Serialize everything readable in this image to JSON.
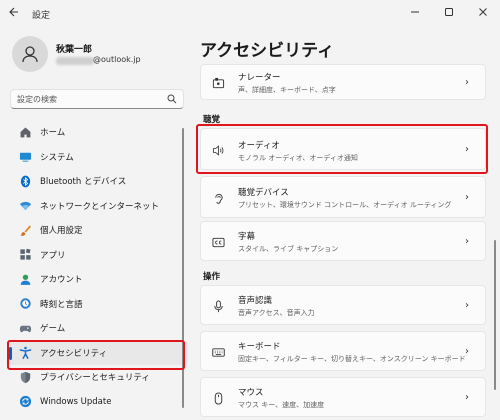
{
  "window": {
    "title": "設定",
    "back_icon": "back-arrow-icon",
    "controls": {
      "minimize": "—",
      "maximize": "☐",
      "close": "✕"
    }
  },
  "profile": {
    "name": "秋葉一郎",
    "email_suffix": "@outlook.jp"
  },
  "search": {
    "placeholder": "設定の検索"
  },
  "sidebar": {
    "items": [
      {
        "label": "ホーム",
        "icon": "home-icon"
      },
      {
        "label": "システム",
        "icon": "system-icon"
      },
      {
        "label": "Bluetooth とデバイス",
        "icon": "bluetooth-icon"
      },
      {
        "label": "ネットワークとインターネット",
        "icon": "wifi-icon"
      },
      {
        "label": "個人用設定",
        "icon": "brush-icon"
      },
      {
        "label": "アプリ",
        "icon": "apps-icon"
      },
      {
        "label": "アカウント",
        "icon": "account-icon"
      },
      {
        "label": "時刻と言語",
        "icon": "globe-clock-icon"
      },
      {
        "label": "ゲーム",
        "icon": "gamepad-icon"
      },
      {
        "label": "アクセシビリティ",
        "icon": "accessibility-icon",
        "selected": true
      },
      {
        "label": "プライバシーとセキュリティ",
        "icon": "shield-icon"
      },
      {
        "label": "Windows Update",
        "icon": "windows-update-icon"
      }
    ]
  },
  "main": {
    "title": "アクセシビリティ",
    "cards": [
      {
        "title": "ナレーター",
        "subtitle": "声、詳細度、キーボード、点字",
        "icon": "narrator-icon"
      },
      {
        "title": "オーディオ",
        "subtitle": "モノラル オーディオ、オーディオ通知",
        "icon": "speaker-icon"
      },
      {
        "title": "聴覚デバイス",
        "subtitle": "プリセット、環境サウンド コントロール、オーディオ ルーティング",
        "icon": "hearing-icon"
      },
      {
        "title": "字幕",
        "subtitle": "スタイル、ライブ キャプション",
        "icon": "captions-icon"
      },
      {
        "title": "音声認識",
        "subtitle": "音声アクセス、音声入力",
        "icon": "microphone-icon"
      },
      {
        "title": "キーボード",
        "subtitle": "固定キー、フィルター キー、切り替えキー、オンスクリーン キーボード",
        "icon": "keyboard-icon"
      },
      {
        "title": "マウス",
        "subtitle": "マウス キー、速度、加速度",
        "icon": "mouse-icon"
      }
    ],
    "sections": {
      "hearing": "聴覚",
      "interaction": "操作"
    }
  },
  "colors": {
    "accent": "#0067c0",
    "highlight": "#e0151d",
    "background": "#f3f3f3"
  }
}
